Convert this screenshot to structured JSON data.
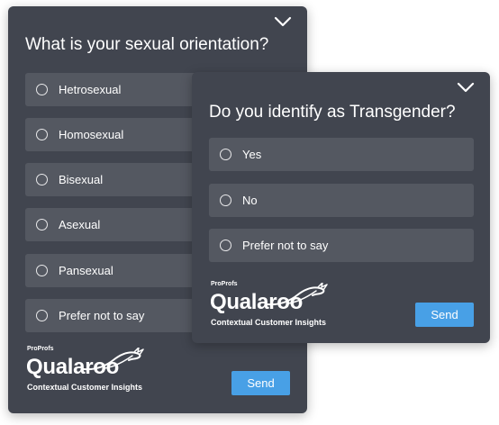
{
  "card_orientation": {
    "question": "What is your sexual orientation?",
    "options": [
      "Hetrosexual",
      "Homosexual",
      "Bisexual",
      "Asexual",
      "Pansexual",
      "Prefer not to say"
    ],
    "send_label": "Send",
    "brand": {
      "sup": "ProProfs",
      "name": "Qualaroo",
      "tagline": "Contextual Customer Insights"
    }
  },
  "card_transgender": {
    "question": "Do you identify as Transgender?",
    "options": [
      "Yes",
      "No",
      "Prefer not to say"
    ],
    "send_label": "Send",
    "brand": {
      "sup": "ProProfs",
      "name": "Qualaroo",
      "tagline": "Contextual Customer Insights"
    }
  },
  "icons": {
    "collapse": "chevron-down-icon",
    "radio": "radio-unchecked-icon",
    "brand_mark": "kangaroo-swirl-icon"
  },
  "colors": {
    "card_bg": "#41454f",
    "option_bg": "#545861",
    "accent": "#48a0e6",
    "text": "#ffffff"
  }
}
